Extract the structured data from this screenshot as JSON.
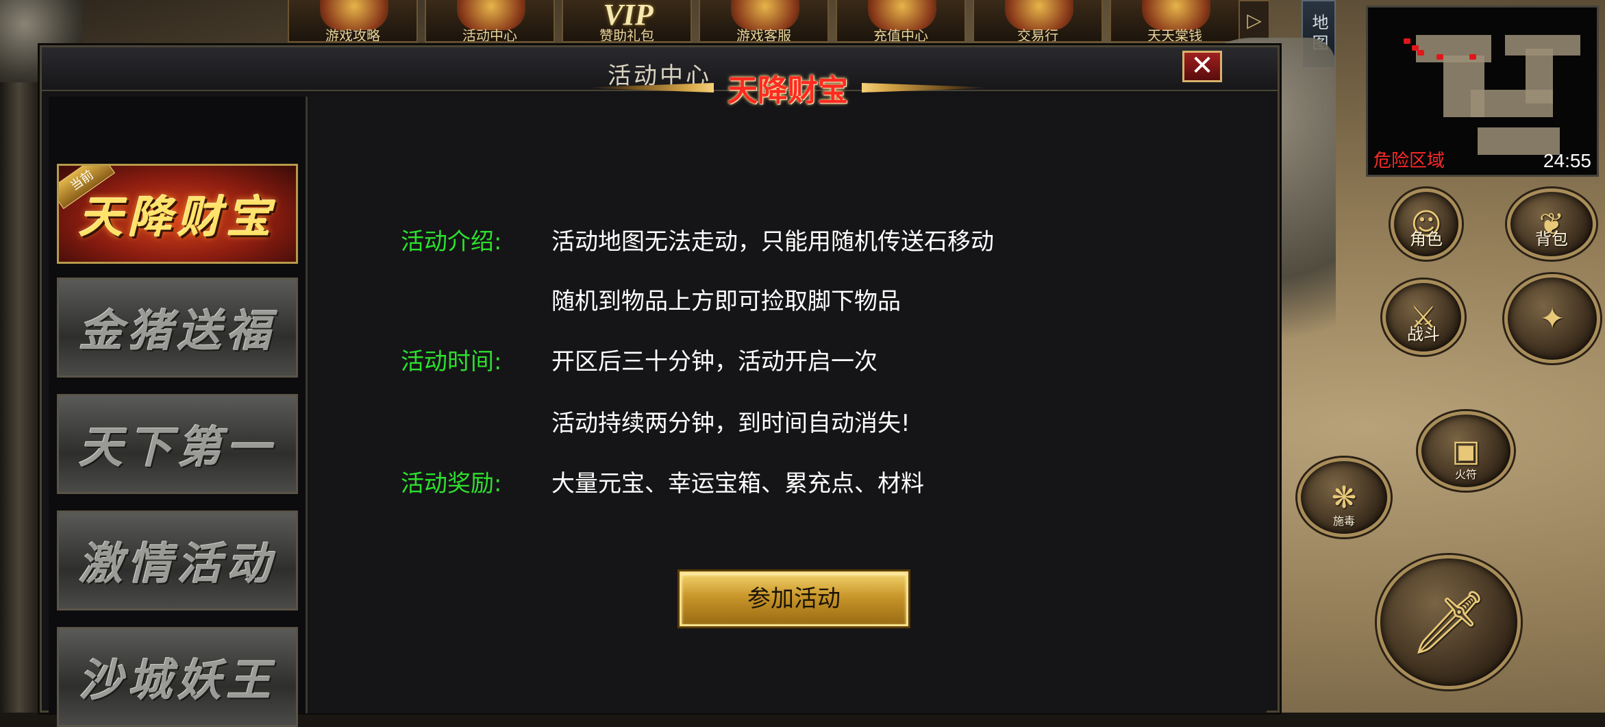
{
  "top_bar": {
    "items": [
      {
        "label": "游戏攻略",
        "icon": "scroll-icon"
      },
      {
        "label": "活动中心",
        "icon": "activity-icon"
      },
      {
        "label": "赞助礼包",
        "icon": "vip-icon",
        "badge": "VIP"
      },
      {
        "label": "游戏客服",
        "icon": "support-icon"
      },
      {
        "label": "充值中心",
        "icon": "gold-ingot-icon"
      },
      {
        "label": "交易行",
        "icon": "trade-icon"
      },
      {
        "label": "天天棠钱",
        "icon": "reward-icon"
      }
    ],
    "arrow": "▷"
  },
  "minimap": {
    "tab_label": "地图",
    "zone_name": "危险区域",
    "time": "24:55"
  },
  "skills": [
    {
      "label": "角色",
      "icon": "character-portrait-icon"
    },
    {
      "label": "背包",
      "icon": "bag-icon"
    },
    {
      "label": "战斗",
      "icon": "crossed-swords-icon"
    },
    {
      "label": "",
      "icon": "shuriken-icon"
    },
    {
      "label": "火符",
      "icon": "talisman-icon"
    },
    {
      "label": "施毒",
      "icon": "poison-icon"
    },
    {
      "label": "",
      "icon": "sword-icon"
    }
  ],
  "panel": {
    "title": "活动中心",
    "close_glyph": "✕",
    "current_badge": "当前",
    "tabs": [
      {
        "label": "天降财宝",
        "active": true
      },
      {
        "label": "金猪送福",
        "active": false
      },
      {
        "label": "天下第一",
        "active": false
      },
      {
        "label": "激情活动",
        "active": false
      },
      {
        "label": "沙城妖王",
        "active": false
      }
    ]
  },
  "event": {
    "title": "天降财宝",
    "intro_label": "活动介绍:",
    "intro_line1": "活动地图无法走动，只能用随机传送石移动",
    "intro_line2": "随机到物品上方即可捡取脚下物品",
    "time_label": "活动时间:",
    "time_line1": "开区后三十分钟，活动开启一次",
    "time_line2": "活动持续两分钟，到时间自动消失!",
    "reward_label": "活动奖励:",
    "reward_text": "大量元宝、幸运宝箱、累充点、材料",
    "join_button": "参加活动"
  },
  "colors": {
    "label_green": "#2de02d",
    "title_red": "#ff2a22",
    "button_gold": "#c9962a",
    "zone_red": "#ff2a2a"
  }
}
